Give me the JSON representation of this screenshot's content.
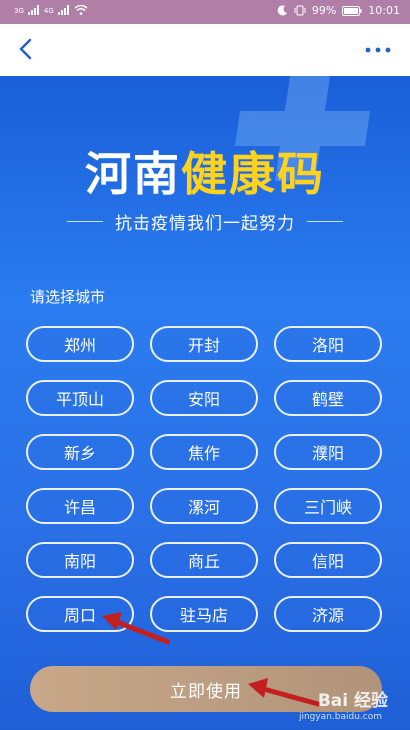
{
  "statusbar": {
    "left_signal_1": "3G",
    "left_signal_2": "4G",
    "battery": "99%",
    "time": "10:01"
  },
  "header": {
    "title_part1": "河南",
    "title_part2": "健康码",
    "subtitle": "抗击疫情我们一起努力"
  },
  "prompt": "请选择城市",
  "cities": [
    "郑州",
    "开封",
    "洛阳",
    "平顶山",
    "安阳",
    "鹤壁",
    "新乡",
    "焦作",
    "濮阳",
    "许昌",
    "漯河",
    "三门峡",
    "南阳",
    "商丘",
    "信阳",
    "周口",
    "驻马店",
    "济源"
  ],
  "submit_label": "立即使用",
  "watermark": {
    "brand": "Bai 经验",
    "url": "jingyan.baidu.com"
  },
  "colors": {
    "accent_yellow": "#ffd21f",
    "background_blue": "#2b7cf0",
    "submit_button": "#b8987d",
    "arrow_red": "#c41f1f"
  }
}
